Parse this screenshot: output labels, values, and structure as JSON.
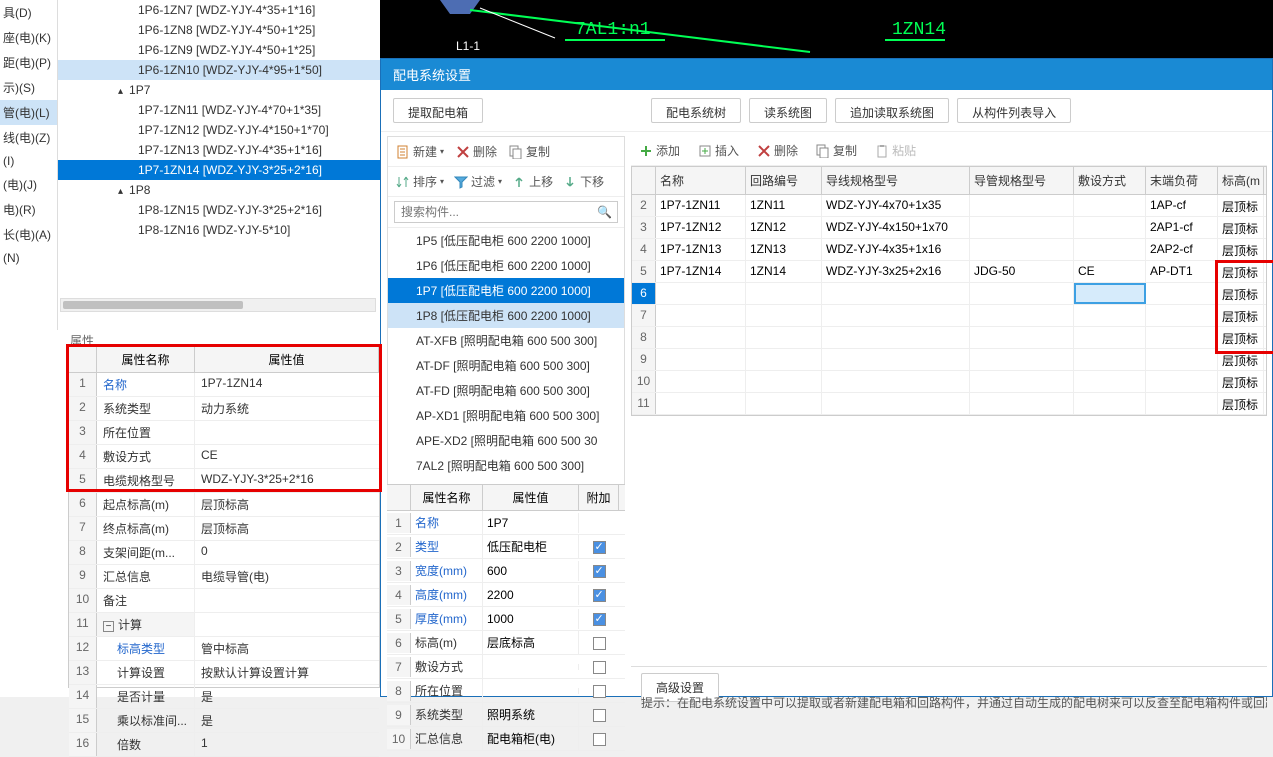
{
  "side_items": [
    "具(D)",
    "座(电)(K)",
    "距(电)(P)",
    "示)(S)",
    "管(电)(L)",
    "线(电)(Z)",
    "(I)",
    "(电)(J)",
    "电)(R)",
    "长(电)(A)",
    "(N)"
  ],
  "side_sel": 4,
  "tree": [
    {
      "t": "1P6-1ZN7 [WDZ-YJY-4*35+1*16]",
      "lvl": 2
    },
    {
      "t": "1P6-1ZN8 [WDZ-YJY-4*50+1*25]",
      "lvl": 2
    },
    {
      "t": "1P6-1ZN9 [WDZ-YJY-4*50+1*25]",
      "lvl": 2
    },
    {
      "t": "1P6-1ZN10 [WDZ-YJY-4*95+1*50]",
      "lvl": 2,
      "hl": true
    },
    {
      "t": "1P7",
      "lvl": 1,
      "parent": true
    },
    {
      "t": "1P7-1ZN11 [WDZ-YJY-4*70+1*35]",
      "lvl": 2
    },
    {
      "t": "1P7-1ZN12 [WDZ-YJY-4*150+1*70]",
      "lvl": 2
    },
    {
      "t": "1P7-1ZN13 [WDZ-YJY-4*35+1*16]",
      "lvl": 2
    },
    {
      "t": "1P7-1ZN14 [WDZ-YJY-3*25+2*16]",
      "lvl": 2,
      "sel": true
    },
    {
      "t": "1P8",
      "lvl": 1,
      "parent": true
    },
    {
      "t": "1P8-1ZN15 [WDZ-YJY-3*25+2*16]",
      "lvl": 2
    },
    {
      "t": "1P8-1ZN16 [WDZ-YJY-5*10]",
      "lvl": 2
    }
  ],
  "prop_label": "属性",
  "prop_head": {
    "name": "属性名称",
    "value": "属性值"
  },
  "props": [
    {
      "n": "名称",
      "v": "1P7-1ZN14",
      "link": true
    },
    {
      "n": "系统类型",
      "v": "动力系统"
    },
    {
      "n": "所在位置",
      "v": ""
    },
    {
      "n": "敷设方式",
      "v": "CE"
    },
    {
      "n": "电缆规格型号",
      "v": "WDZ-YJY-3*25+2*16"
    },
    {
      "n": "起点标高(m)",
      "v": "层顶标高"
    },
    {
      "n": "终点标高(m)",
      "v": "层顶标高"
    },
    {
      "n": "支架间距(m...",
      "v": "0"
    },
    {
      "n": "汇总信息",
      "v": "电缆导管(电)"
    },
    {
      "n": "备注",
      "v": ""
    },
    {
      "n": "计算",
      "v": "",
      "group": true
    },
    {
      "n": "标高类型",
      "v": "管中标高",
      "link": true,
      "indent": true
    },
    {
      "n": "计算设置",
      "v": "按默认计算设置计算",
      "indent": true
    },
    {
      "n": "是否计量",
      "v": "是",
      "indent": true
    },
    {
      "n": "乘以标准间...",
      "v": "是",
      "indent": true
    },
    {
      "n": "倍数",
      "v": "1",
      "indent": true
    }
  ],
  "cad": {
    "t1": "7AL1:n1",
    "t2": "1ZN14",
    "t3": "L1-1"
  },
  "dlg_title": "配电系统设置",
  "top_buttons": [
    "提取配电箱",
    "配电系统树",
    "读系统图",
    "追加读取系统图",
    "从构件列表导入"
  ],
  "ml_tools": [
    {
      "t": "新建",
      "drop": true
    },
    {
      "t": "删除"
    },
    {
      "t": "复制"
    }
  ],
  "ml_tools2": [
    {
      "t": "排序",
      "drop": true
    },
    {
      "t": "过滤",
      "drop": true
    },
    {
      "t": "上移"
    },
    {
      "t": "下移"
    }
  ],
  "search_ph": "搜索构件...",
  "comps": [
    {
      "t": "1P5 [低压配电柜 600 2200 1000]"
    },
    {
      "t": "1P6 [低压配电柜 600 2200 1000]"
    },
    {
      "t": "1P7 [低压配电柜 600 2200 1000]",
      "sel": true
    },
    {
      "t": "1P8 [低压配电柜 600 2200 1000]",
      "hl": true
    },
    {
      "t": "AT-XFB [照明配电箱 600 500 300]"
    },
    {
      "t": "AT-DF [照明配电箱 600 500 300]"
    },
    {
      "t": "AT-FD [照明配电箱 600 500 300]"
    },
    {
      "t": "AP-XD1 [照明配电箱 600 500 300]"
    },
    {
      "t": "APE-XD2 [照明配电箱 600 500 30"
    },
    {
      "t": "7AL2 [照明配电箱 600 500 300]",
      "cut": true
    }
  ],
  "mlp_head": {
    "n": "属性名称",
    "v": "属性值",
    "a": "附加"
  },
  "mlp": [
    {
      "n": "名称",
      "v": "1P7",
      "link": true
    },
    {
      "n": "类型",
      "v": "低压配电柜",
      "link": true,
      "chk": true
    },
    {
      "n": "宽度(mm)",
      "v": "600",
      "link": true,
      "chk": true
    },
    {
      "n": "高度(mm)",
      "v": "2200",
      "link": true,
      "chk": true
    },
    {
      "n": "厚度(mm)",
      "v": "1000",
      "link": true,
      "chk": true
    },
    {
      "n": "标高(m)",
      "v": "层底标高",
      "chk": false
    },
    {
      "n": "敷设方式",
      "v": "",
      "chk": false
    },
    {
      "n": "所在位置",
      "v": "",
      "chk": false
    },
    {
      "n": "系统类型",
      "v": "照明系统",
      "chk": false
    },
    {
      "n": "汇总信息",
      "v": "配电箱柜(电)",
      "chk": false
    }
  ],
  "mr_tools": [
    {
      "t": "添加",
      "ico": "plus"
    },
    {
      "t": "插入",
      "ico": "insert"
    },
    {
      "t": "删除",
      "ico": "del"
    },
    {
      "t": "复制",
      "ico": "copy"
    },
    {
      "t": "粘贴",
      "ico": "paste",
      "dis": true
    }
  ],
  "grid_head": [
    "名称",
    "回路编号",
    "导线规格型号",
    "导管规格型号",
    "敷设方式",
    "末端负荷",
    "标高(m"
  ],
  "grid_rows": [
    {
      "c": [
        "1P7-1ZN11",
        "1ZN11",
        "WDZ-YJY-4x70+1x35",
        "",
        "",
        "1AP-cf",
        "层顶标"
      ]
    },
    {
      "c": [
        "1P7-1ZN12",
        "1ZN12",
        "WDZ-YJY-4x150+1x70",
        "",
        "",
        "2AP1-cf",
        "层顶标"
      ]
    },
    {
      "c": [
        "1P7-1ZN13",
        "1ZN13",
        "WDZ-YJY-4x35+1x16",
        "",
        "",
        "2AP2-cf",
        "层顶标"
      ]
    },
    {
      "c": [
        "1P7-1ZN14",
        "1ZN14",
        "WDZ-YJY-3x25+2x16",
        "JDG-50",
        "CE",
        "AP-DT1",
        "层顶标"
      ]
    },
    {
      "c": [
        "",
        "",
        "",
        "",
        "",
        "",
        "层顶标"
      ],
      "sel": true,
      "active": 4
    },
    {
      "c": [
        "",
        "",
        "",
        "",
        "",
        "",
        "层顶标"
      ]
    },
    {
      "c": [
        "",
        "",
        "",
        "",
        "",
        "",
        "层顶标"
      ]
    },
    {
      "c": [
        "",
        "",
        "",
        "",
        "",
        "",
        "层顶标"
      ]
    },
    {
      "c": [
        "",
        "",
        "",
        "",
        "",
        "",
        "层顶标"
      ]
    },
    {
      "c": [
        "",
        "",
        "",
        "",
        "",
        "",
        "层顶标"
      ]
    }
  ],
  "adv": "高级设置",
  "hint": "提示：在配电系统设置中可以提取或者新建配电箱和回路构件，并通过自动生成的配电树来可以反查至配电箱构件或回路构"
}
